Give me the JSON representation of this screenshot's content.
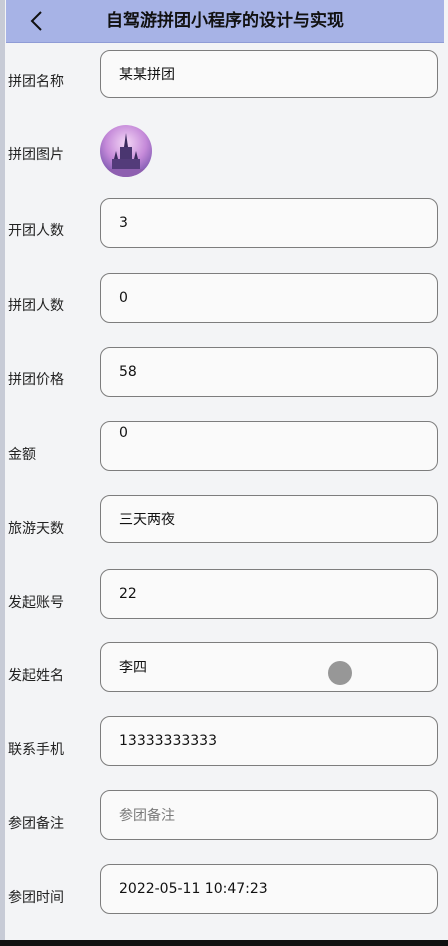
{
  "header": {
    "title": "自驾游拼团小程序的设计与实现"
  },
  "form": {
    "group_name": {
      "label": "拼团名称",
      "value": "某某拼团"
    },
    "group_image": {
      "label": "拼团图片"
    },
    "open_count": {
      "label": "开团人数",
      "value": "3"
    },
    "join_count": {
      "label": "拼团人数",
      "value": "0"
    },
    "price": {
      "label": "拼团价格",
      "value": "58"
    },
    "amount": {
      "label": "金额",
      "value": "0"
    },
    "travel_days": {
      "label": "旅游天数",
      "value": "三天两夜"
    },
    "initiator_account": {
      "label": "发起账号",
      "value": "22"
    },
    "initiator_name": {
      "label": "发起姓名",
      "value": "李四"
    },
    "contact_phone": {
      "label": "联系手机",
      "value": "13333333333"
    },
    "remark": {
      "label": "参团备注",
      "placeholder": "参团备注"
    },
    "join_time": {
      "label": "参团时间",
      "value": "2022-05-11 10:47:23"
    }
  },
  "colors": {
    "header_bg": "#a7b3e6",
    "field_border": "#7d7d7d",
    "page_bg": "#f3f4f6"
  },
  "icons": {
    "back": "chevron-left-icon"
  }
}
